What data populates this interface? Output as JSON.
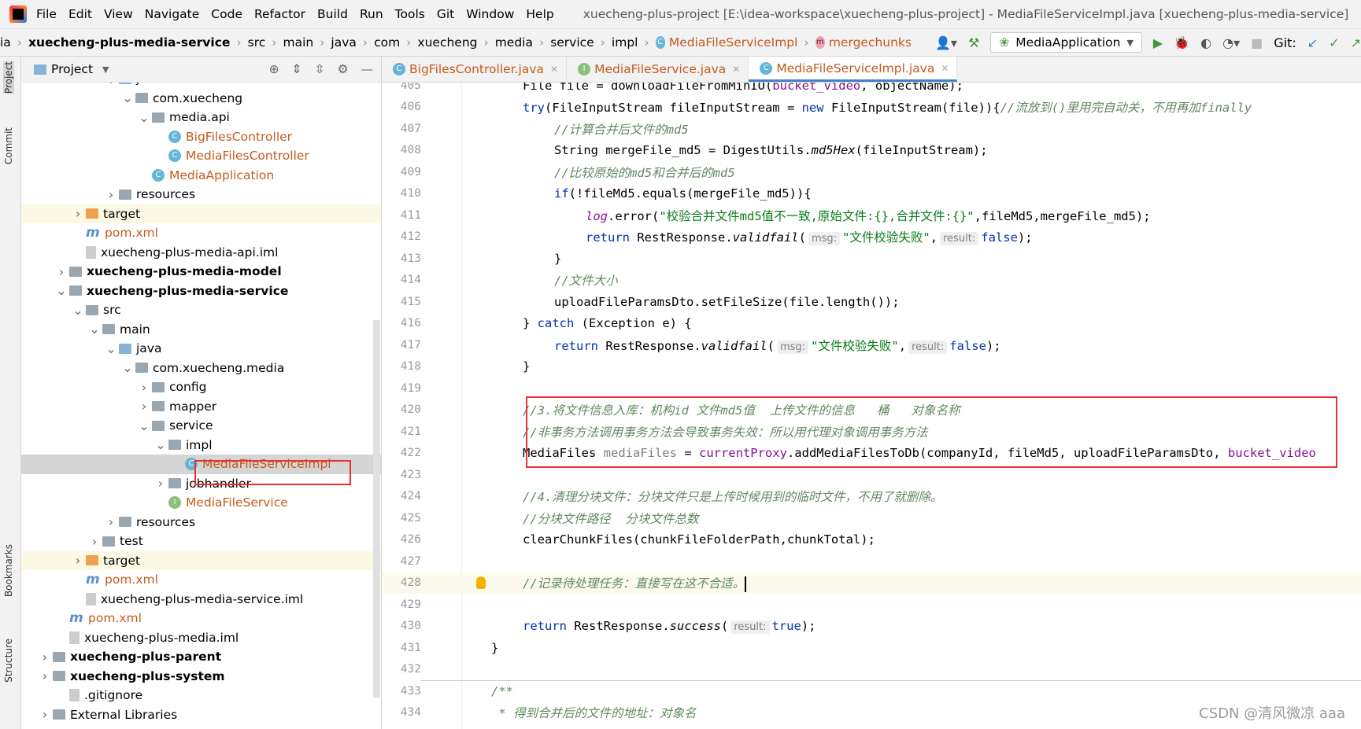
{
  "menubar": {
    "items": [
      "File",
      "Edit",
      "View",
      "Navigate",
      "Code",
      "Refactor",
      "Build",
      "Run",
      "Tools",
      "Git",
      "Window",
      "Help"
    ],
    "window_title": "xuecheng-plus-project [E:\\idea-workspace\\xuecheng-plus-project] - MediaFileServiceImpl.java [xuecheng-plus-media-service]"
  },
  "breadcrumb": {
    "items": [
      "ia",
      "xuecheng-plus-media-service",
      "src",
      "main",
      "java",
      "com",
      "xuecheng",
      "media",
      "service",
      "impl"
    ],
    "class": "MediaFileServiceImpl",
    "method": "mergechunks"
  },
  "toolbar": {
    "run_config": "MediaApplication",
    "git_label": "Git:"
  },
  "sidebar": {
    "project": "Project",
    "commit": "Commit",
    "bookmarks": "Bookmarks",
    "structure": "Structure"
  },
  "project_panel": {
    "title": "Project"
  },
  "tree": [
    {
      "label": "java",
      "level": 4,
      "arrow": "v",
      "icon": "blue"
    },
    {
      "label": "com.xuecheng",
      "level": 5,
      "arrow": "v",
      "icon": "pkg"
    },
    {
      "label": "media.api",
      "level": 6,
      "arrow": "v",
      "icon": "pkg"
    },
    {
      "label": "BigFilesController",
      "level": 7,
      "icon": "cls",
      "color": "orange"
    },
    {
      "label": "MediaFilesController",
      "level": 7,
      "icon": "cls",
      "color": "orange"
    },
    {
      "label": "MediaApplication",
      "level": 6,
      "icon": "cls",
      "color": "orange"
    },
    {
      "label": "resources",
      "level": 4,
      "arrow": ">",
      "icon": "pkg"
    },
    {
      "label": "target",
      "level": 2,
      "arrow": ">",
      "icon": "orange",
      "hl": true
    },
    {
      "label": "pom.xml",
      "level": 2,
      "icon": "pom",
      "color": "orange"
    },
    {
      "label": "xuecheng-plus-media-api.iml",
      "level": 2,
      "icon": "file"
    },
    {
      "label": "xuecheng-plus-media-model",
      "level": 1,
      "arrow": ">",
      "icon": "pkg",
      "bold": true
    },
    {
      "label": "xuecheng-plus-media-service",
      "level": 1,
      "arrow": "v",
      "icon": "pkg",
      "bold": true
    },
    {
      "label": "src",
      "level": 2,
      "arrow": "v",
      "icon": "pkg"
    },
    {
      "label": "main",
      "level": 3,
      "arrow": "v",
      "icon": "pkg"
    },
    {
      "label": "java",
      "level": 4,
      "arrow": "v",
      "icon": "blue"
    },
    {
      "label": "com.xuecheng.media",
      "level": 5,
      "arrow": "v",
      "icon": "pkg"
    },
    {
      "label": "config",
      "level": 6,
      "arrow": ">",
      "icon": "pkg"
    },
    {
      "label": "mapper",
      "level": 6,
      "arrow": ">",
      "icon": "pkg"
    },
    {
      "label": "service",
      "level": 6,
      "arrow": "v",
      "icon": "pkg"
    },
    {
      "label": "impl",
      "level": 7,
      "arrow": "v",
      "icon": "pkg"
    },
    {
      "label": "MediaFileServiceImpl",
      "level": 8,
      "icon": "cls",
      "color": "orange",
      "sel": true
    },
    {
      "label": "jobhandler",
      "level": 7,
      "arrow": ">",
      "icon": "pkg"
    },
    {
      "label": "MediaFileService",
      "level": 7,
      "icon": "intf",
      "color": "orange"
    },
    {
      "label": "resources",
      "level": 4,
      "arrow": ">",
      "icon": "pkg"
    },
    {
      "label": "test",
      "level": 3,
      "arrow": ">",
      "icon": "pkg"
    },
    {
      "label": "target",
      "level": 2,
      "arrow": ">",
      "icon": "orange",
      "hl": true
    },
    {
      "label": "pom.xml",
      "level": 2,
      "icon": "pom",
      "color": "orange"
    },
    {
      "label": "xuecheng-plus-media-service.iml",
      "level": 2,
      "icon": "file"
    },
    {
      "label": "pom.xml",
      "level": 1,
      "icon": "pom",
      "color": "orange"
    },
    {
      "label": "xuecheng-plus-media.iml",
      "level": 1,
      "icon": "file"
    },
    {
      "label": "xuecheng-plus-parent",
      "level": 0,
      "arrow": ">",
      "icon": "pkg",
      "bold": true
    },
    {
      "label": "xuecheng-plus-system",
      "level": 0,
      "arrow": ">",
      "icon": "pkg",
      "bold": true
    },
    {
      "label": ".gitignore",
      "level": 1,
      "icon": "file"
    },
    {
      "label": "External Libraries",
      "level": 0,
      "arrow": ">",
      "icon": "pkg"
    }
  ],
  "tabs": [
    {
      "label": "BigFilesController.java",
      "icon": "C"
    },
    {
      "label": "MediaFileService.java",
      "icon": "I"
    },
    {
      "label": "MediaFileServiceImpl.java",
      "icon": "C",
      "active": true
    }
  ],
  "code": [
    {
      "n": "405",
      "i": 1,
      "t": [
        [
          "File file = downloadFileFromMinIO(",
          ""
        ],
        [
          "bucket_video",
          "fld"
        ],
        [
          ", objectName);",
          ""
        ]
      ]
    },
    {
      "n": "406",
      "i": 1,
      "t": [
        [
          "try",
          "kw"
        ],
        [
          "(FileInputStream fileInputStream = ",
          ""
        ],
        [
          "new",
          "kw"
        ],
        [
          " FileInputStream(file)){",
          ""
        ],
        [
          "//流放到()里用完自动关，不用再加finally",
          "cmt"
        ]
      ]
    },
    {
      "n": "407",
      "i": 2,
      "t": [
        [
          "//计算合并后文件的md5",
          "cmt"
        ]
      ]
    },
    {
      "n": "408",
      "i": 2,
      "t": [
        [
          "String mergeFile_md5 = DigestUtils.",
          ""
        ],
        [
          "md5Hex",
          "it"
        ],
        [
          "(fileInputStream);",
          ""
        ]
      ]
    },
    {
      "n": "409",
      "i": 2,
      "t": [
        [
          "//比较原始的md5和合并后的md5",
          "cmt"
        ]
      ]
    },
    {
      "n": "410",
      "i": 2,
      "t": [
        [
          "if",
          "kw"
        ],
        [
          "(!fileMd5.equals(mergeFile_md5)){",
          ""
        ]
      ]
    },
    {
      "n": "411",
      "i": 3,
      "t": [
        [
          "log",
          "fld it"
        ],
        [
          ".error(",
          ""
        ],
        [
          "\"校验合并文件md5值不一致,原始文件:{},合并文件:{}\"",
          "str"
        ],
        [
          ",fileMd5,mergeFile_md5);",
          ""
        ]
      ]
    },
    {
      "n": "412",
      "i": 3,
      "t": [
        [
          "return",
          "kw"
        ],
        [
          " RestResponse.",
          ""
        ],
        [
          "validfail",
          "it"
        ],
        [
          "(",
          ""
        ],
        [
          "msg:",
          "hint"
        ],
        [
          "\"文件校验失败\"",
          "str"
        ],
        [
          ",",
          ""
        ],
        [
          "result:",
          "hint"
        ],
        [
          "false",
          "kw"
        ],
        [
          ");",
          ""
        ]
      ]
    },
    {
      "n": "413",
      "i": 2,
      "t": [
        [
          "}",
          ""
        ]
      ]
    },
    {
      "n": "414",
      "i": 2,
      "t": [
        [
          "//文件大小",
          "cmt"
        ]
      ]
    },
    {
      "n": "415",
      "i": 2,
      "t": [
        [
          "uploadFileParamsDto.setFileSize(file.length());",
          ""
        ]
      ]
    },
    {
      "n": "416",
      "i": 1,
      "t": [
        [
          "} ",
          ""
        ],
        [
          "catch",
          "kw"
        ],
        [
          " (Exception e) {",
          ""
        ]
      ]
    },
    {
      "n": "417",
      "i": 2,
      "t": [
        [
          "return",
          "kw"
        ],
        [
          " RestResponse.",
          ""
        ],
        [
          "validfail",
          "it"
        ],
        [
          "(",
          ""
        ],
        [
          "msg:",
          "hint"
        ],
        [
          "\"文件校验失败\"",
          "str"
        ],
        [
          ",",
          ""
        ],
        [
          "result:",
          "hint"
        ],
        [
          "false",
          "kw"
        ],
        [
          ");",
          ""
        ]
      ]
    },
    {
      "n": "418",
      "i": 1,
      "t": [
        [
          "}",
          ""
        ]
      ]
    },
    {
      "n": "419",
      "i": 0,
      "t": []
    },
    {
      "n": "420",
      "i": 1,
      "t": [
        [
          "//3.将文件信息入库：机构id 文件md5值  上传文件的信息   桶   对象名称",
          "cmt"
        ]
      ]
    },
    {
      "n": "421",
      "i": 1,
      "t": [
        [
          "//非事务方法调用事务方法会导致事务失效：所以用代理对象调用事务方法",
          "cmt"
        ]
      ]
    },
    {
      "n": "422",
      "i": 1,
      "t": [
        [
          "MediaFiles ",
          ""
        ],
        [
          "mediaFiles",
          "gray"
        ],
        [
          " = ",
          ""
        ],
        [
          "currentProxy",
          "fld"
        ],
        [
          ".addMediaFilesToDb(companyId, fileMd5, uploadFileParamsDto, ",
          ""
        ],
        [
          "bucket_video",
          "fld"
        ]
      ]
    },
    {
      "n": "423",
      "i": 0,
      "t": []
    },
    {
      "n": "424",
      "i": 1,
      "t": [
        [
          "//4.清理分块文件：分块文件只是上传时候用到的临时文件，不用了就删除。",
          "cmt"
        ]
      ]
    },
    {
      "n": "425",
      "i": 1,
      "t": [
        [
          "//分块文件路径  分块文件总数",
          "cmt"
        ]
      ]
    },
    {
      "n": "426",
      "i": 1,
      "t": [
        [
          "clearChunkFiles(chunkFileFolderPath,chunkTotal);",
          ""
        ]
      ]
    },
    {
      "n": "427",
      "i": 0,
      "t": []
    },
    {
      "n": "428",
      "i": 1,
      "t": [
        [
          "//记录待处理任务：直接写在这不合适。",
          "cmt"
        ]
      ],
      "cur": true
    },
    {
      "n": "429",
      "i": 0,
      "t": []
    },
    {
      "n": "430",
      "i": 1,
      "t": [
        [
          "return",
          "kw"
        ],
        [
          " RestResponse.",
          ""
        ],
        [
          "success",
          "it"
        ],
        [
          "(",
          ""
        ],
        [
          "result:",
          "hint"
        ],
        [
          "true",
          "kw"
        ],
        [
          ");",
          ""
        ]
      ]
    },
    {
      "n": "431",
      "i": 0,
      "t": [
        [
          "}",
          ""
        ]
      ]
    },
    {
      "n": "432",
      "i": 0,
      "t": []
    },
    {
      "n": "433",
      "i": 0,
      "t": [
        [
          "/**",
          "cmt"
        ]
      ]
    },
    {
      "n": "434",
      "i": 0,
      "t": [
        [
          " * 得到合并后的文件的地址：对象名",
          "cmt"
        ]
      ]
    }
  ],
  "watermark": "CSDN @清风微凉 aaa"
}
